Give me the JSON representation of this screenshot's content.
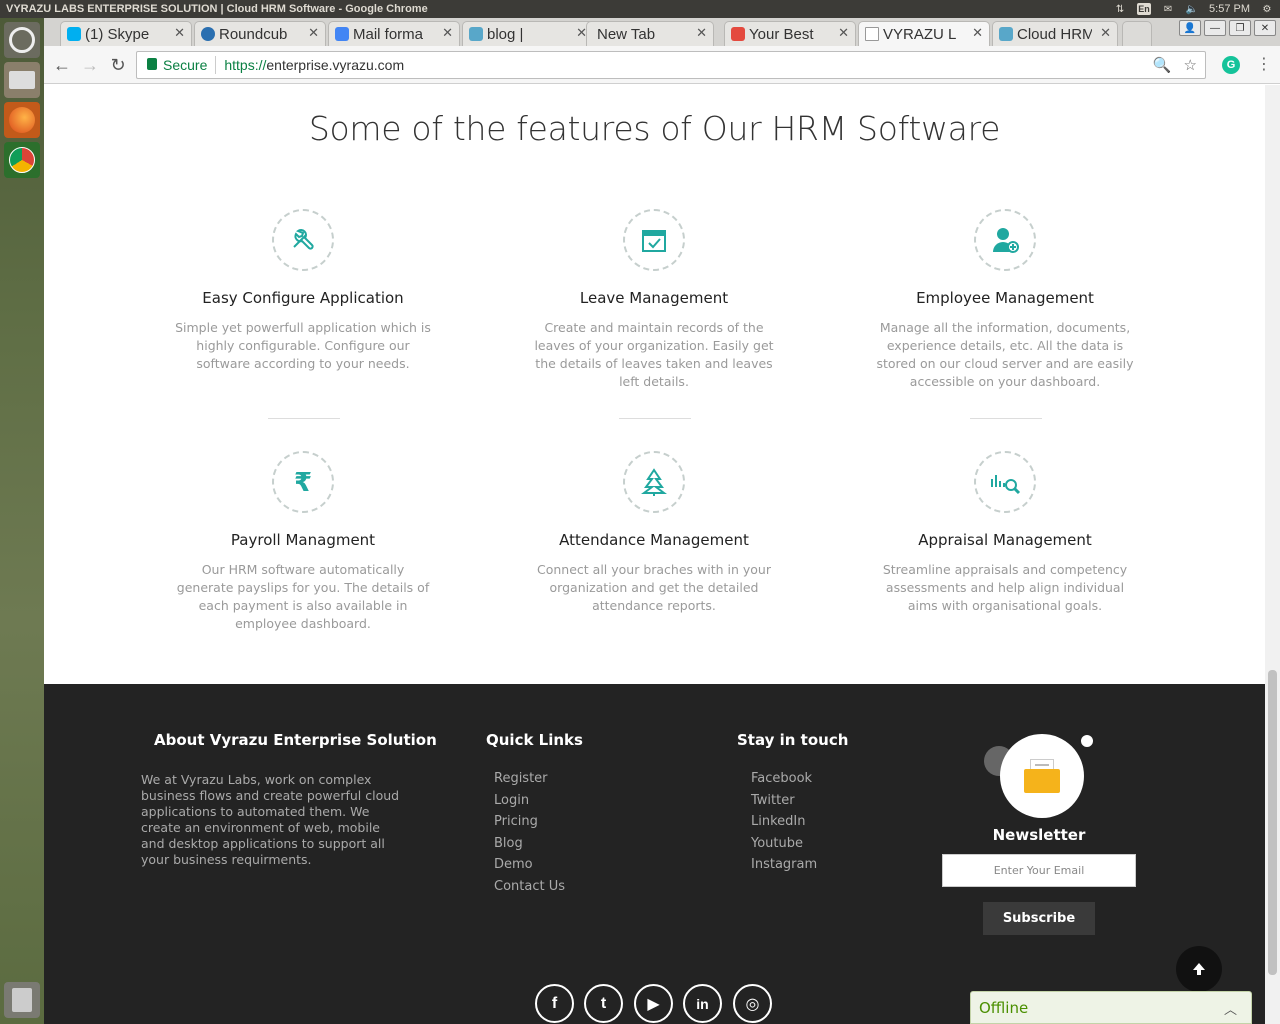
{
  "os": {
    "window_title": "VYRAZU LABS ENTERPRISE SOLUTION | Cloud HRM Software - Google Chrome",
    "keyboard_layout": "En",
    "clock": "5:57 PM"
  },
  "browser": {
    "tabs": [
      {
        "label": "(1) Skype",
        "color": "#00aff0"
      },
      {
        "label": "Roundcub",
        "color": "#2a6fb0"
      },
      {
        "label": "Mail forma",
        "color": "#4285f4"
      },
      {
        "label": "blog |",
        "color": "#58a7c9"
      },
      {
        "label": "New Tab",
        "color": ""
      },
      {
        "label": "Your Best",
        "color": "#e44a3f"
      },
      {
        "label": "VYRAZU L",
        "color": "#999999"
      },
      {
        "label": "Cloud HRM",
        "color": "#58a7c9"
      }
    ],
    "secure_label": "Secure",
    "url_scheme": "https://",
    "url_host": "enterprise.vyrazu.com"
  },
  "features": {
    "heading": "Some of the features of Our HRM Software",
    "accent": "#20a8a0",
    "items": [
      {
        "icon": "wrench-screwdriver-icon",
        "title": "Easy Configure Application",
        "desc": "Simple yet powerfull application which is highly configurable. Configure our software according to your needs."
      },
      {
        "icon": "calendar-check-icon",
        "title": "Leave Management",
        "desc": "Create and maintain records of the leaves of your organization. Easily get the details of leaves taken and leaves left details."
      },
      {
        "icon": "user-add-icon",
        "title": "Employee Management",
        "desc": "Manage all the information, documents, experience details, etc. All the data is stored on our cloud server and are easily accessible on your dashboard."
      },
      {
        "icon": "rupee-icon",
        "title": "Payroll Managment",
        "desc": "Our HRM software automatically generate payslips for you. The details of each payment is also available in employee dashboard."
      },
      {
        "icon": "tree-network-icon",
        "title": "Attendance Management",
        "desc": "Connect all your braches with in your organization and get the detailed attendance reports."
      },
      {
        "icon": "chart-search-icon",
        "title": "Appraisal Management",
        "desc": "Streamline appraisals and competency assessments and help align individual aims with organisational goals."
      }
    ]
  },
  "footer": {
    "about_heading": "About Vyrazu Enterprise Solution",
    "about_text": "We at Vyrazu Labs, work on complex business flows and create powerful cloud applications to automated them. We create an environment of web, mobile and desktop applications to support all your business requirments.",
    "quick_heading": "Quick Links",
    "quick_links": [
      "Register",
      "Login",
      "Pricing",
      "Blog",
      "Demo",
      "Contact Us"
    ],
    "touch_heading": "Stay in touch",
    "touch_links": [
      "Facebook",
      "Twitter",
      "LinkedIn",
      "Youtube",
      "Instagram"
    ],
    "newsletter_title": "Newsletter",
    "email_placeholder": "Enter Your Email",
    "subscribe_label": "Subscribe",
    "social": [
      "f",
      "t",
      "▶",
      "in",
      "◎"
    ]
  },
  "chat": {
    "status": "Offline"
  }
}
